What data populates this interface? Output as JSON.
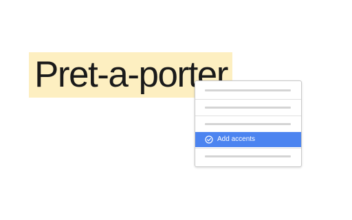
{
  "selection": {
    "text": "Pret-a-porter",
    "highlight_color": "#fdefc1"
  },
  "context_menu": {
    "items": [
      {
        "type": "placeholder"
      },
      {
        "type": "placeholder"
      },
      {
        "type": "placeholder"
      },
      {
        "type": "action",
        "label": "Add accents",
        "icon": "check-circle-icon",
        "selected": true,
        "highlight_color": "#4c84f0"
      },
      {
        "type": "placeholder"
      }
    ]
  }
}
